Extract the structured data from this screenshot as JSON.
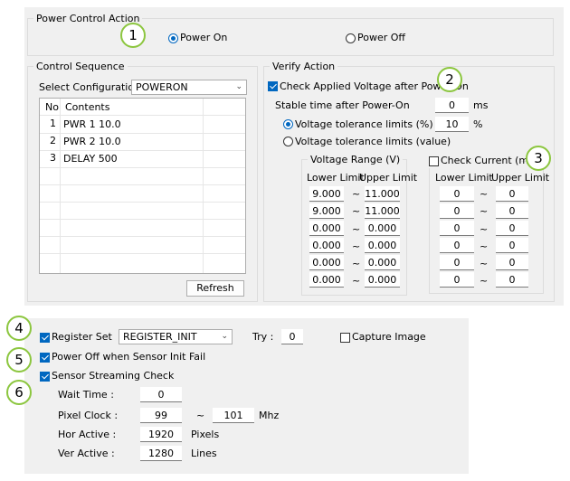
{
  "callouts": [
    "1",
    "2",
    "3",
    "4",
    "5",
    "6"
  ],
  "power_control": {
    "title": "Power Control Action",
    "power_on": "Power On",
    "power_off": "Power Off",
    "selected": "Power On"
  },
  "control_sequence": {
    "title": "Control Sequence",
    "select_label": "Select Configuration :",
    "config_value": "POWERON",
    "headers": {
      "no": "No",
      "contents": "Contents"
    },
    "rows": [
      {
        "no": "1",
        "contents": "PWR 1 10.0"
      },
      {
        "no": "2",
        "contents": "PWR 2 10.0"
      },
      {
        "no": "3",
        "contents": "DELAY 500"
      }
    ],
    "refresh": "Refresh"
  },
  "verify": {
    "title": "Verify Action",
    "check_voltage": "Check Applied Voltage after Power On",
    "check_voltage_checked": true,
    "stable_label": "Stable time after Power-On",
    "stable_value": "0",
    "stable_unit": "ms",
    "tol_percent": "Voltage tolerance limits (%)",
    "tol_percent_value": "10",
    "tol_percent_unit": "%",
    "tol_value": "Voltage tolerance limits (value)",
    "tol_selected": "percent",
    "voltage_range_title": "Voltage Range (V)",
    "lower": "Lower Limit",
    "upper": "Upper Limit",
    "tilde": "~",
    "voltage_rows": [
      {
        "lower": "9.000",
        "upper": "11.000"
      },
      {
        "lower": "9.000",
        "upper": "11.000"
      },
      {
        "lower": "0.000",
        "upper": "0.000"
      },
      {
        "lower": "0.000",
        "upper": "0.000"
      },
      {
        "lower": "0.000",
        "upper": "0.000"
      },
      {
        "lower": "0.000",
        "upper": "0.000"
      }
    ],
    "check_current": "Check Current (mA)",
    "check_current_checked": false,
    "current_rows": [
      {
        "lower": "0",
        "upper": "0"
      },
      {
        "lower": "0",
        "upper": "0"
      },
      {
        "lower": "0",
        "upper": "0"
      },
      {
        "lower": "0",
        "upper": "0"
      },
      {
        "lower": "0",
        "upper": "0"
      },
      {
        "lower": "0",
        "upper": "0"
      }
    ]
  },
  "sensor": {
    "register_set": "Register Set",
    "register_set_checked": true,
    "register_value": "REGISTER_INIT",
    "try_label": "Try :",
    "try_value": "0",
    "capture_image": "Capture Image",
    "capture_checked": false,
    "power_off_fail": "Power Off when Sensor Init Fail",
    "power_off_fail_checked": true,
    "streaming_check": "Sensor Streaming Check",
    "streaming_checked": true,
    "wait_time_label": "Wait Time :",
    "wait_time_value": "0",
    "pixel_clock_label": "Pixel Clock :",
    "pixel_clock_min": "99",
    "pixel_clock_max": "101",
    "pixel_clock_unit": "Mhz",
    "hor_active_label": "Hor Active :",
    "hor_active_value": "1920",
    "hor_unit": "Pixels",
    "ver_active_label": "Ver Active :",
    "ver_active_value": "1280",
    "ver_unit": "Lines"
  }
}
